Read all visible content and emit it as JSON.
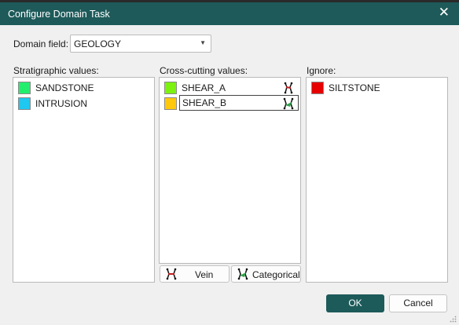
{
  "window": {
    "title": "Configure Domain Task",
    "close_symbol": "✕"
  },
  "domain_field": {
    "label": "Domain field:",
    "value": "GEOLOGY"
  },
  "stratigraphic": {
    "label": "Stratigraphic values:",
    "items": [
      {
        "label": "SANDSTONE",
        "color": "#22ee6e"
      },
      {
        "label": "INTRUSION",
        "color": "#1ec8f0"
      }
    ]
  },
  "crosscutting": {
    "label": "Cross-cutting values:",
    "items": [
      {
        "label": "SHEAR_A",
        "color": "#7cf20e",
        "icon": "vein-icon",
        "editing": false
      },
      {
        "label": "SHEAR_B",
        "color": "#ffc80a",
        "icon": "categorical-icon",
        "editing": true
      }
    ],
    "vein_button": "Vein",
    "categorical_button": "Categorical"
  },
  "ignore": {
    "label": "Ignore:",
    "items": [
      {
        "label": "SILTSTONE",
        "color": "#e60000"
      }
    ]
  },
  "buttons": {
    "ok": "OK",
    "cancel": "Cancel"
  },
  "colors": {
    "titlebar": "#1e5a5a",
    "ok_button": "#1d5a5a"
  }
}
